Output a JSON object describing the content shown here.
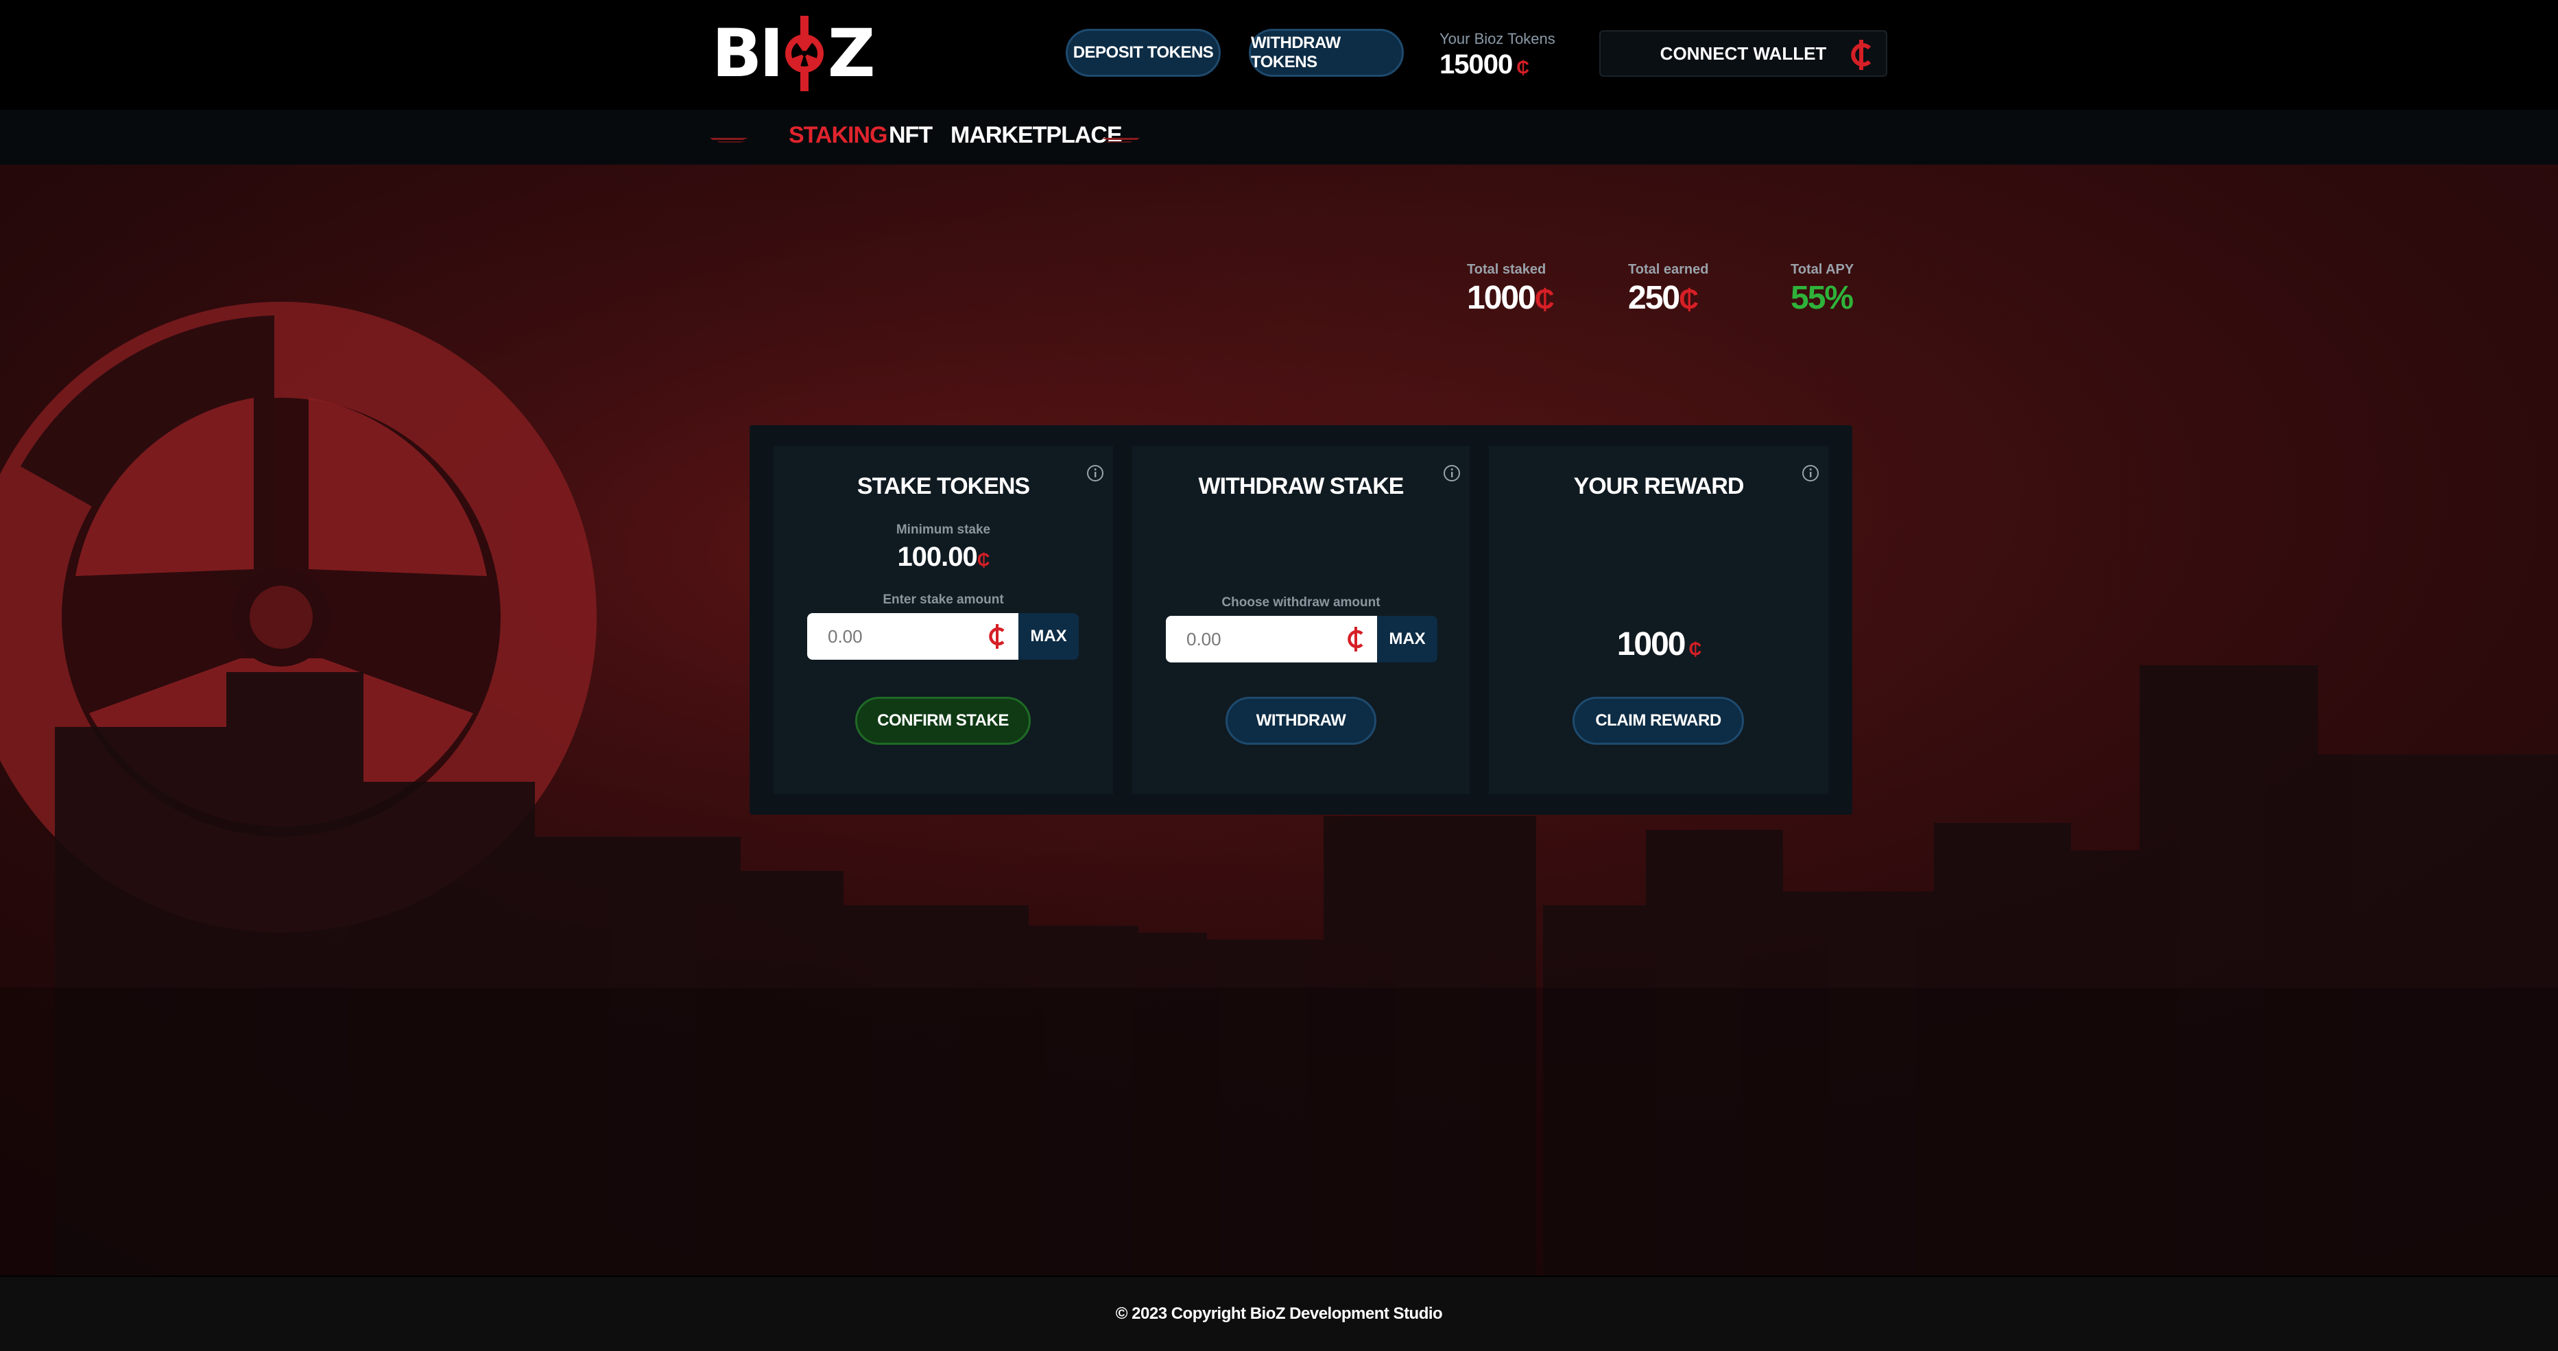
{
  "header": {
    "logo_text_left": "BI",
    "logo_text_right": "Z",
    "deposit_label": "DEPOSIT TOKENS",
    "withdraw_tokens_label": "WITHDRAW TOKENS",
    "tokens_label": "Your Bioz Tokens",
    "tokens_value": "15000",
    "connect_wallet_label": "CONNECT WALLET"
  },
  "nav": {
    "items": [
      {
        "label": "STAKING",
        "active": true
      },
      {
        "label": "NFT",
        "active": false
      },
      {
        "label": "MARKETPLACE",
        "active": false
      }
    ]
  },
  "stats": {
    "total_staked_label": "Total staked",
    "total_staked_value": "1000",
    "total_earned_label": "Total earned",
    "total_earned_value": "250",
    "total_apy_label": "Total APY",
    "total_apy_value": "55%"
  },
  "stake_card": {
    "title": "STAKE TOKENS",
    "min_label": "Minimum stake",
    "min_value": "100.00",
    "enter_label": "Enter stake amount",
    "input_placeholder": "0.00",
    "max_label": "MAX",
    "confirm_label": "CONFIRM STAKE"
  },
  "withdraw_card": {
    "title": "WITHDRAW STAKE",
    "choose_label": "Choose withdraw amount",
    "input_placeholder": "0.00",
    "max_label": "MAX",
    "withdraw_label": "WITHDRAW"
  },
  "reward_card": {
    "title": "YOUR REWARD",
    "reward_value": "1000",
    "claim_label": "CLAIM REWARD"
  },
  "footer": {
    "copyright": "© 2023 Copyright BioZ Development Studio"
  },
  "colors": {
    "accent_red": "#d61f26",
    "apy_green": "#2eb33a",
    "button_blue": "#0d2c45",
    "button_green": "#0f3a14"
  },
  "icons": {
    "currency": "bioz-coin-icon",
    "info": "info-icon",
    "logo_mark": "biohazard-icon"
  }
}
